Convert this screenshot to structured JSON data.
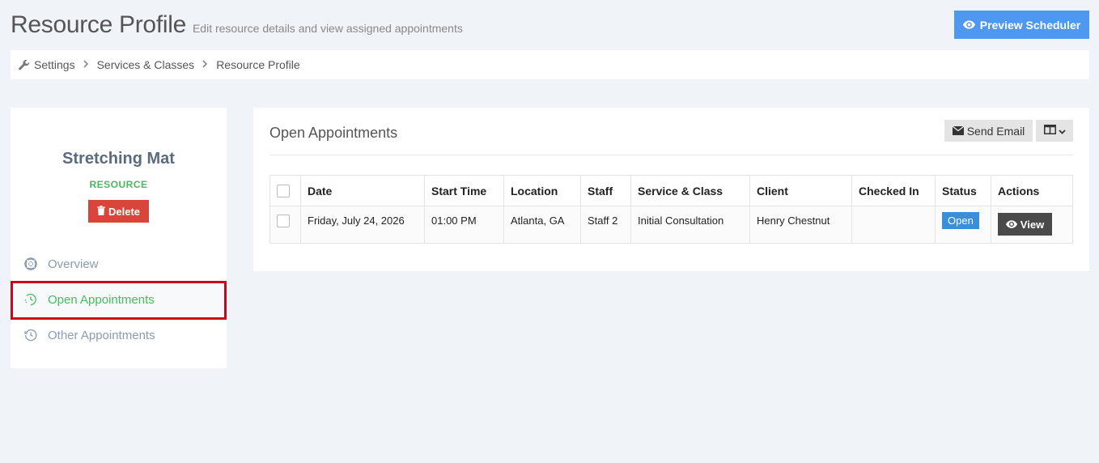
{
  "header": {
    "title": "Resource Profile",
    "subtitle": "Edit resource details and view assigned appointments",
    "preview_button": "Preview Scheduler"
  },
  "breadcrumb": {
    "items": [
      "Settings",
      "Services & Classes",
      "Resource Profile"
    ]
  },
  "resource": {
    "name": "Stretching Mat",
    "type": "RESOURCE",
    "delete_label": "Delete"
  },
  "nav": {
    "items": [
      {
        "label": "Overview",
        "icon": "lifebuoy-icon"
      },
      {
        "label": "Open Appointments",
        "icon": "clock-icon"
      },
      {
        "label": "Other Appointments",
        "icon": "history-icon"
      }
    ],
    "active": "Open Appointments"
  },
  "panel": {
    "title": "Open Appointments",
    "send_email_label": "Send Email"
  },
  "table": {
    "headers": [
      "Date",
      "Start Time",
      "Location",
      "Staff",
      "Service & Class",
      "Client",
      "Checked In",
      "Status",
      "Actions"
    ],
    "rows": [
      {
        "date": "Friday, July 24, 2026",
        "start_time": "01:00 PM",
        "location": "Atlanta, GA",
        "staff": "Staff 2",
        "service": "Initial Consultation",
        "client": "Henry Chestnut",
        "checked_in": "",
        "status": "Open",
        "action": "View"
      }
    ]
  },
  "colors": {
    "accent_blue": "#4e98f2",
    "active_green": "#4cb860",
    "delete_red": "#d9453a",
    "highlight_red": "#d0021b"
  }
}
